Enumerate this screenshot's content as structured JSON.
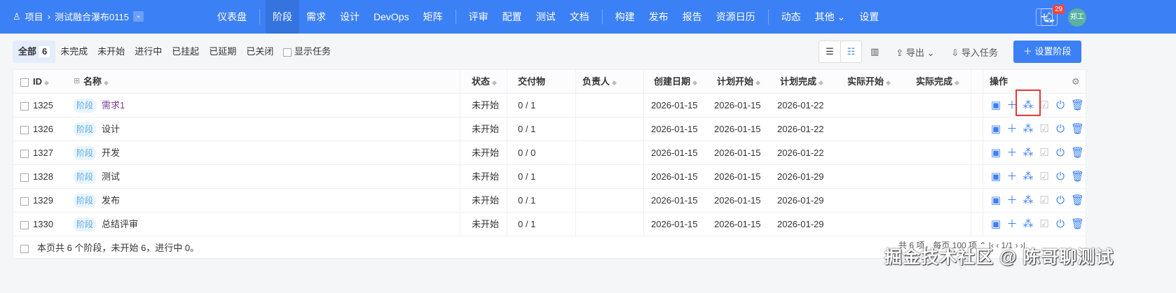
{
  "nav": {
    "project_icon": "rocket-icon",
    "project": "项目",
    "current": "测试融合瀑布0115",
    "menu": [
      "仪表盘",
      "阶段",
      "需求",
      "设计",
      "DevOps",
      "矩阵",
      "评审",
      "配置",
      "测试",
      "文档",
      "构建",
      "发布",
      "报告",
      "资源日历",
      "动态",
      "其他",
      "设置"
    ],
    "active": "阶段",
    "notifications": "29",
    "avatar": "郑工"
  },
  "filters": {
    "items": [
      "全部",
      "未完成",
      "未开始",
      "进行中",
      "已挂起",
      "已延期",
      "已关闭"
    ],
    "all_count": "6",
    "show_tasks": "显示任务"
  },
  "toolbar": {
    "export": "导出",
    "import": "导入任务",
    "add": "设置阶段"
  },
  "table": {
    "headers": {
      "id": "ID",
      "name": "名称",
      "status": "状态",
      "deliverable": "交付物",
      "owner": "负责人",
      "created": "创建日期",
      "plan_start": "计划开始",
      "plan_end": "计划完成",
      "actual_start": "实际开始",
      "actual_end": "实际完成",
      "actions": "操作"
    },
    "rows": [
      {
        "id": "1325",
        "tag": "阶段",
        "name": "需求1",
        "status": "未开始",
        "deliverable": "0 / 1",
        "created": "2026-01-15",
        "plan_start": "2026-01-15",
        "plan_end": "2026-01-22"
      },
      {
        "id": "1326",
        "tag": "阶段",
        "name": "设计",
        "status": "未开始",
        "deliverable": "0 / 1",
        "created": "2026-01-15",
        "plan_start": "2026-01-15",
        "plan_end": "2026-01-22"
      },
      {
        "id": "1327",
        "tag": "阶段",
        "name": "开发",
        "status": "未开始",
        "deliverable": "0 / 0",
        "created": "2026-01-15",
        "plan_start": "2026-01-15",
        "plan_end": "2026-01-22"
      },
      {
        "id": "1328",
        "tag": "阶段",
        "name": "测试",
        "status": "未开始",
        "deliverable": "0 / 1",
        "created": "2026-01-15",
        "plan_start": "2026-01-15",
        "plan_end": "2026-01-29"
      },
      {
        "id": "1329",
        "tag": "阶段",
        "name": "发布",
        "status": "未开始",
        "deliverable": "0 / 1",
        "created": "2026-01-15",
        "plan_start": "2026-01-15",
        "plan_end": "2026-01-29"
      },
      {
        "id": "1330",
        "tag": "阶段",
        "name": "总结评审",
        "status": "未开始",
        "deliverable": "0 / 1",
        "created": "2026-01-15",
        "plan_start": "2026-01-15",
        "plan_end": "2026-01-29"
      }
    ],
    "footer": "本页共 6 个阶段，未开始 6，进行中 0。",
    "pager": "共 6 项，每页 100 项 ⌃   |‹   ‹   1/1   ›   ›|"
  },
  "watermark": "掘金技术社区 @ 陈哥聊测试",
  "colors": {
    "nav": "#3c80f5",
    "highlight": "#e23b33"
  }
}
